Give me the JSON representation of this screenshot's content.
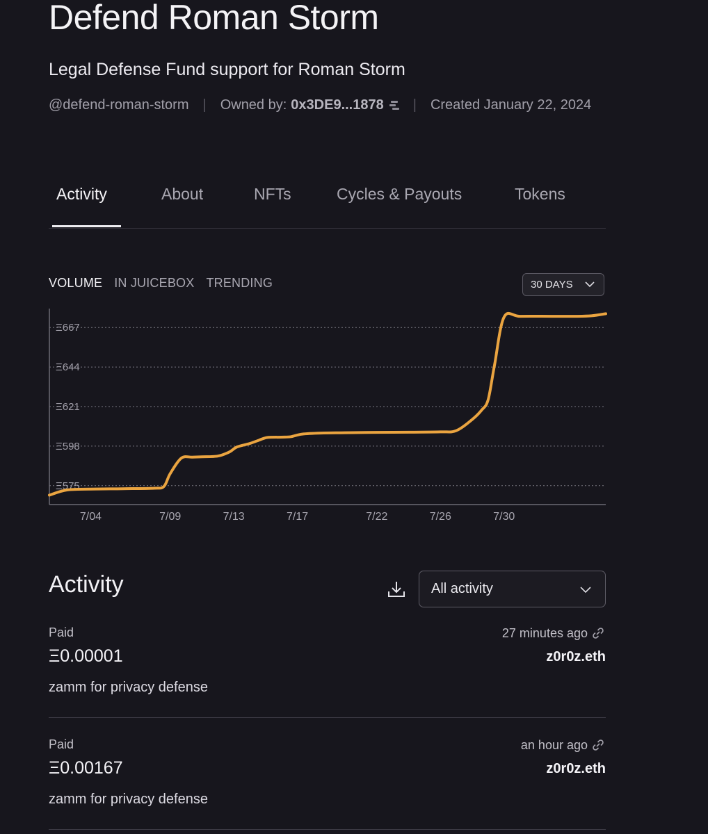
{
  "project": {
    "title": "Defend Roman Storm",
    "subtitle": "Legal Defense Fund support for Roman Storm",
    "handle": "@defend-roman-storm",
    "owner_label": "Owned by:",
    "owner_value": "0x3DE9...1878",
    "created": "Created January 22, 2024"
  },
  "tabs": [
    {
      "label": "Activity",
      "active": true
    },
    {
      "label": "About",
      "active": false
    },
    {
      "label": "NFTs",
      "active": false
    },
    {
      "label": "Cycles & Payouts",
      "active": false
    },
    {
      "label": "Tokens",
      "active": false
    }
  ],
  "chart_tabs": [
    {
      "label": "VOLUME",
      "active": true
    },
    {
      "label": "IN JUICEBOX",
      "active": false
    },
    {
      "label": "TRENDING",
      "active": false
    }
  ],
  "range_select": {
    "value": "30 DAYS"
  },
  "chart_data": {
    "type": "line",
    "title": "",
    "xlabel": "",
    "ylabel": "",
    "unit_prefix": "Ξ",
    "x_ticks": [
      "7/04",
      "7/09",
      "7/13",
      "7/17",
      "7/22",
      "7/26",
      "7/30"
    ],
    "x_tick_days": [
      4,
      9,
      13,
      17,
      22,
      26,
      30
    ],
    "y_ticks": [
      575,
      598,
      621,
      644,
      667
    ],
    "xlim": [
      1.4,
      36.4
    ],
    "ylim": [
      564,
      678
    ],
    "grid": "horizontal-dotted",
    "color": "#eaa440",
    "series": [
      {
        "x": [
          1.4,
          2.5,
          4,
          6,
          8,
          8.6,
          9,
          9.7,
          10.4,
          11,
          12,
          12.7,
          13.2,
          14,
          14.6,
          15.1,
          16,
          16.6,
          17.3,
          18.5,
          20,
          22,
          24,
          26,
          27,
          28,
          28.6,
          29,
          29.4,
          30,
          31,
          33,
          34.5,
          35.5,
          36.4
        ],
        "y": [
          569.5,
          572.5,
          573,
          573.2,
          573.5,
          574.5,
          582,
          591,
          591.6,
          591.8,
          592.2,
          594.5,
          597.5,
          599.5,
          601.5,
          603,
          603.2,
          603.5,
          605,
          605.6,
          605.8,
          606,
          606.1,
          606.3,
          607,
          613.5,
          619,
          625,
          645,
          673,
          673.5,
          673.5,
          673.5,
          673.8,
          675
        ]
      }
    ]
  },
  "activity": {
    "title": "Activity",
    "filter": {
      "value": "All activity"
    },
    "items": [
      {
        "kind": "Paid",
        "amount": "Ξ0.00001",
        "memo": "zamm for privacy defense",
        "time": "27 minutes ago",
        "from": "z0r0z.eth"
      },
      {
        "kind": "Paid",
        "amount": "Ξ0.00167",
        "memo": "zamm for privacy defense",
        "time": "an hour ago",
        "from": "z0r0z.eth"
      }
    ]
  },
  "colors": {
    "background": "#17161d",
    "accent_line": "#eaa440",
    "muted_text": "#a19fa9"
  }
}
